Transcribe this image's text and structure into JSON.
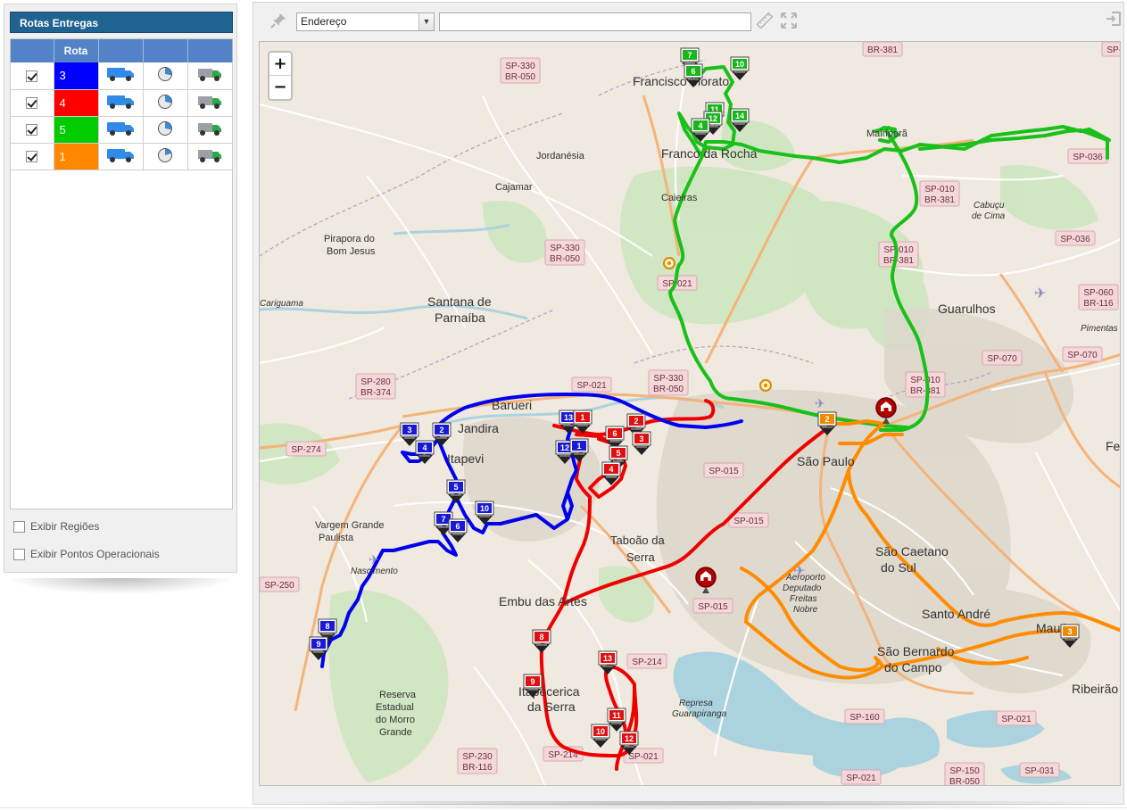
{
  "panel": {
    "title": "Rotas Entregas",
    "column_header": "Rota",
    "routes": [
      {
        "number": "3",
        "color": "#0000ff",
        "checked": true
      },
      {
        "number": "4",
        "color": "#ff0000",
        "checked": true
      },
      {
        "number": "5",
        "color": "#00cc00",
        "checked": true
      },
      {
        "number": "1",
        "color": "#ff8800",
        "checked": true
      }
    ],
    "option_regions": "Exibir Regiões",
    "option_points": "Exibir Pontos Operacionais"
  },
  "toolbar": {
    "search_type": "Endereço",
    "search_value": ""
  },
  "map": {
    "zoom_in": "+",
    "zoom_out": "−",
    "places": [
      "Francisco Morato",
      "Franco da Rocha",
      "Jordanésia",
      "Cajamar",
      "Caieiras",
      "Mairiporã",
      "Pirapora do",
      "Bom Jesus",
      "Santana de",
      "Parnaíba",
      "Guarulhos",
      "Barueri",
      "Jandira",
      "Itapevi",
      "Vargem Grande",
      "Paulista",
      "Taboão da",
      "Serra",
      "São Paulo",
      "Embu das Artes",
      "São Caetano",
      "do Sul",
      "Santo André",
      "São Bernardo",
      "do Campo",
      "Mauá",
      "Ribeirão",
      "Itapecerica",
      "da Serra",
      "Reserva",
      "Estadual",
      "do Morro",
      "Grande",
      "Cabuçu",
      "de Cima",
      "Pimentas",
      "Aeroporto",
      "Deputado",
      "Freitas",
      "Nobre",
      "Represa",
      "Guarapiranga",
      "Nascimento",
      "Fer",
      "Cariguama"
    ],
    "highways": [
      "BR-381",
      "SP-330",
      "BR-050",
      "SP-036",
      "SP-010",
      "SP-021",
      "SP-060",
      "BR-116",
      "SP-070",
      "SP-280",
      "BR-374",
      "SP-274",
      "SP-015",
      "SP-250",
      "SP-214",
      "SP-160",
      "SP-230",
      "SP-031",
      "SP-150"
    ]
  }
}
